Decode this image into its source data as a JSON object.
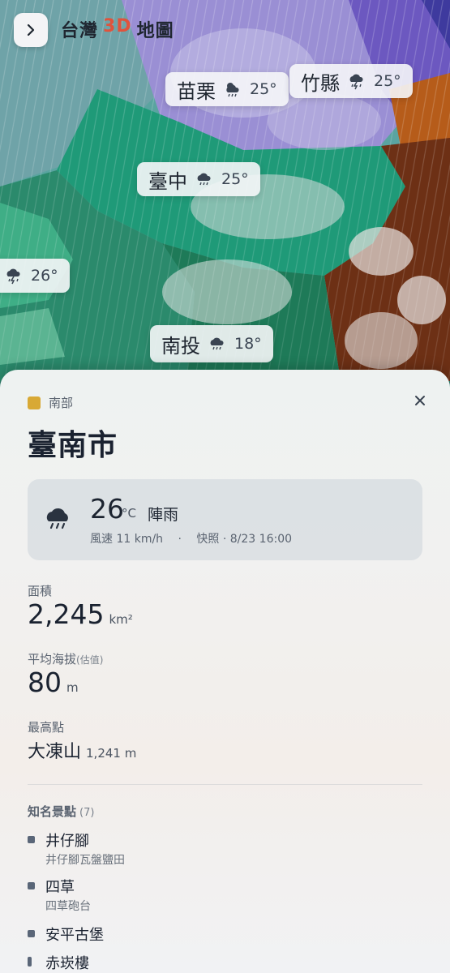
{
  "header": {
    "title_prefix": "台灣",
    "title_accent": "3D",
    "title_suffix": "地圖",
    "back_icon": "chevron-right-icon"
  },
  "map": {
    "labels": [
      {
        "name": "苗栗",
        "temp": "25°",
        "icon": "rain-sun-icon"
      },
      {
        "name": "竹縣",
        "temp": "25°",
        "icon": "thunderstorm-icon"
      },
      {
        "name": "臺中",
        "temp": "25°",
        "icon": "rain-icon"
      },
      {
        "name": "",
        "temp": "26°",
        "icon": "thunderstorm-icon"
      },
      {
        "name": "南投",
        "temp": "18°",
        "icon": "rain-icon"
      }
    ]
  },
  "panel": {
    "region": "南部",
    "region_color": "#d8a935",
    "city": "臺南市",
    "weather": {
      "temp": "26",
      "unit": "°C",
      "condition": "陣雨",
      "wind": "風速 11 km/h",
      "separator": "·",
      "snapshot": "快照 · 8/23 16:00",
      "icon": "rain-icon"
    },
    "area": {
      "label": "面積",
      "value": "2,245",
      "unit": "km²"
    },
    "elevation": {
      "label": "平均海拔",
      "note": "(估值)",
      "value": "80",
      "unit": "m"
    },
    "peak": {
      "label": "最高點",
      "name": "大凍山",
      "height": "1,241 m"
    },
    "attractions": {
      "label": "知名景點",
      "count": "(7)",
      "items": [
        {
          "name": "井仔腳",
          "desc": "井仔腳瓦盤鹽田"
        },
        {
          "name": "四草",
          "desc": "四草砲台"
        },
        {
          "name": "安平古堡",
          "desc": ""
        },
        {
          "name": "赤崁樓",
          "desc": ""
        }
      ]
    }
  }
}
